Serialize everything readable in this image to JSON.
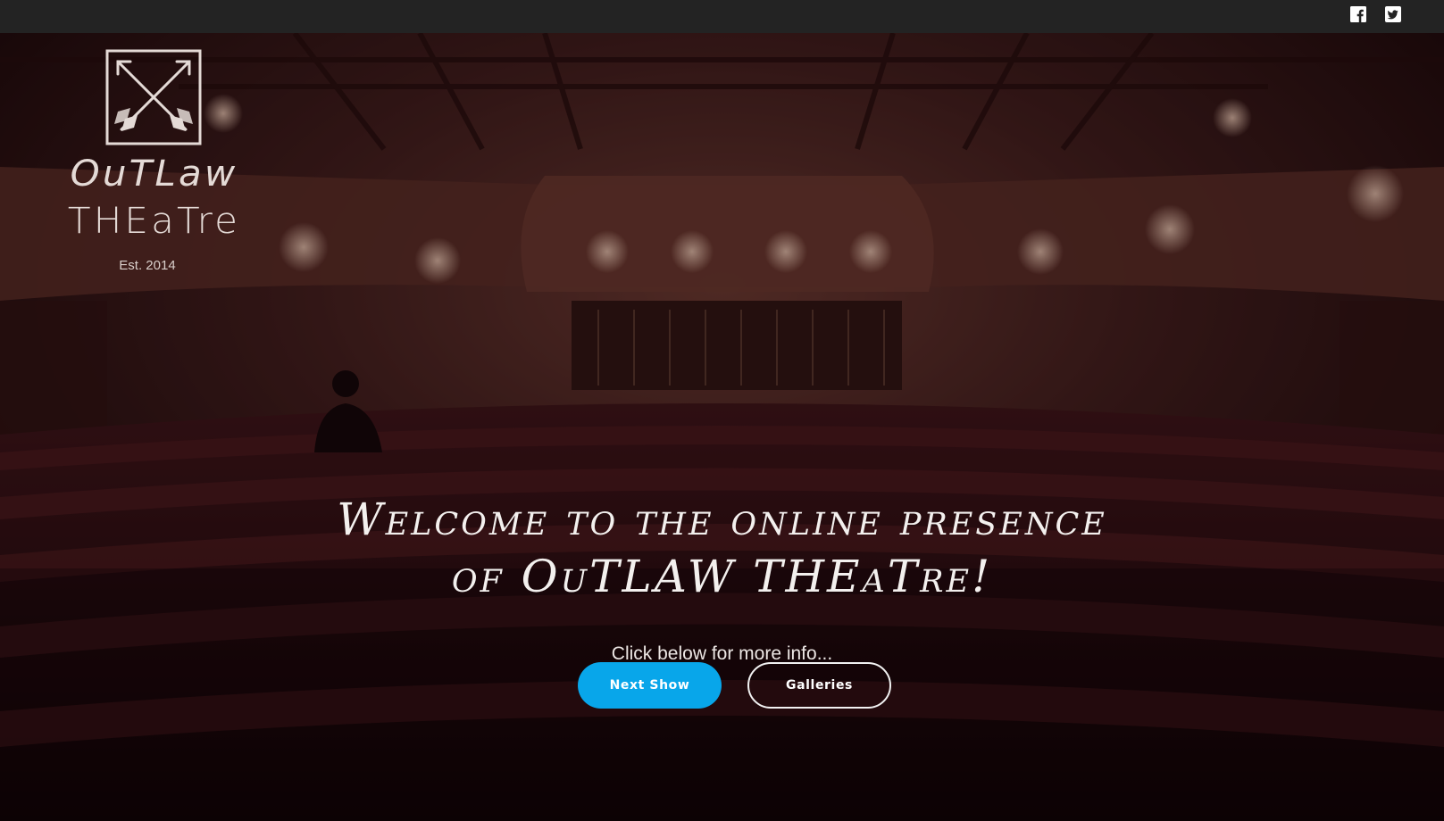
{
  "topbar": {
    "social": [
      {
        "name": "facebook-icon"
      },
      {
        "name": "twitter-icon"
      }
    ]
  },
  "logo": {
    "line1": "OuTLaw",
    "line2": "THEaTre",
    "established": "Est. 2014"
  },
  "hero": {
    "headline_line1": "Welcome to the online presence",
    "headline_line2": "of OuTLAW THEaTre!",
    "subtitle": "Click below for more info...",
    "buttons": {
      "next_show": "Next Show",
      "galleries": "Galleries"
    }
  },
  "colors": {
    "topbar": "#232323",
    "accent": "#08a6ea",
    "overlay": "#2a0c0f"
  }
}
